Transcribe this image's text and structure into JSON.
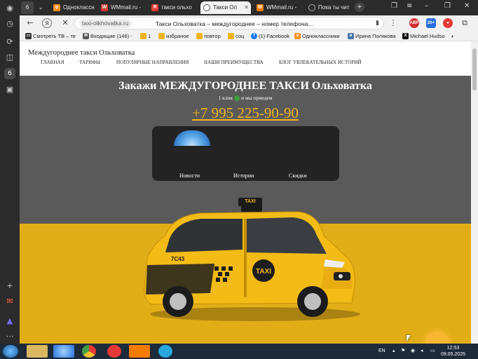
{
  "sidebar": {
    "badge": "6"
  },
  "tabs": [
    {
      "label": "Одноклассн",
      "favicon": "ok-icon",
      "color": "#f7931e"
    },
    {
      "label": "WMmail.ru -",
      "favicon": "wmmail-icon",
      "color": "#d23b2f"
    },
    {
      "label": "такси ольхо",
      "favicon": "yandex-icon",
      "color": "#e53935"
    },
    {
      "label": "Такси Ол",
      "favicon": "loading-icon",
      "color": "#555555",
      "active": true
    },
    {
      "label": "WMmail.ru -",
      "favicon": "wmmail-icon",
      "color": "#f57c00"
    },
    {
      "label": "Пока ты чит",
      "favicon": "loading-icon",
      "color": "#888888"
    }
  ],
  "tab_counter": "6",
  "address": {
    "domain": "taxi-olkhovatka.ru",
    "title": "Такси Ольховатка – междугороднее – номер телефона..."
  },
  "extensions": [
    "ABP",
    "20+"
  ],
  "bookmarks": [
    {
      "label": "Смотреть ТВ – те",
      "icon": "tv-icon",
      "color": "#333333"
    },
    {
      "label": "Входящие (146) -",
      "icon": "mail-icon",
      "color": "#555555"
    },
    {
      "label": "1",
      "icon": "folder-icon",
      "color": "#f2b51a"
    },
    {
      "label": "избраное",
      "icon": "folder-icon",
      "color": "#f2b51a"
    },
    {
      "label": "повтор",
      "icon": "folder-icon",
      "color": "#f2b51a"
    },
    {
      "label": "соц",
      "icon": "folder-icon",
      "color": "#f2b51a"
    },
    {
      "label": "(1) Facebook",
      "icon": "facebook-icon",
      "color": "#1877f2"
    },
    {
      "label": "Одноклассники",
      "icon": "ok-icon",
      "color": "#f7931e"
    },
    {
      "label": "Ирина Полякова",
      "icon": "vk-icon",
      "color": "#4a76a8"
    },
    {
      "label": "Michael Hudso",
      "icon": "x-icon",
      "color": "#111111"
    }
  ],
  "site": {
    "brand": "Междугороднее такси Ольховатка",
    "nav": [
      "ГЛАВНАЯ",
      "ТАРИФЫ",
      "ПОПУЛЯРНЫЕ НАПРАВЛЕНИЯ",
      "НАШИ ПРЕИМУЩЕСТВА",
      "БЛОГ УВЛЕКАТЕЛЬНЫХ ИСТОРИЙ"
    ],
    "hero_title": "Закажи МЕЖДУГОРОДНЕЕ ТАКСИ Ольховатка",
    "hero_sub_a": "1 клик",
    "hero_sub_b": "и мы приедем",
    "phone": "+7 995 225-90-90",
    "panel_links": [
      "Новости",
      "Истории",
      "Скидки"
    ],
    "taxi_sign": "TAXI",
    "taxi_door": "TAXI",
    "taxi_side": "7С43"
  },
  "taskbar": {
    "lang": "EN",
    "time": "12:53",
    "date": "09.05.2025"
  }
}
